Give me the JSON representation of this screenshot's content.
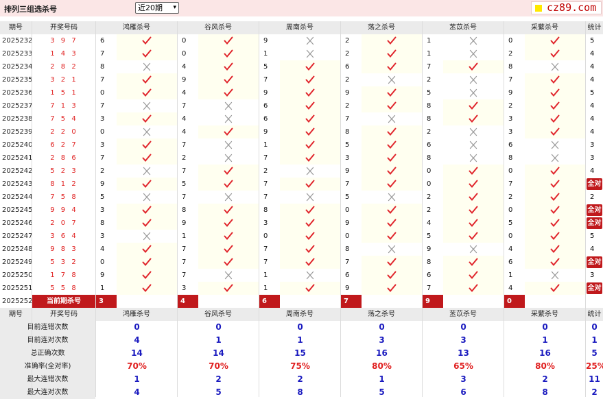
{
  "header": {
    "title": "排列三组选杀号",
    "period_select": "近20期",
    "logo": "cz89.com"
  },
  "columns": {
    "issue": "期号",
    "draw": "开奖号码",
    "experts": [
      "鸿雁杀号",
      "谷风杀号",
      "周南杀号",
      "荡之杀号",
      "苤苡杀号",
      "采蘩杀号"
    ],
    "stat": "统计"
  },
  "rows": [
    {
      "issue": "2025232",
      "draw": "3 9 7",
      "picks": [
        [
          "6",
          "ok"
        ],
        [
          "0",
          "ok"
        ],
        [
          "9",
          "no"
        ],
        [
          "2",
          "ok"
        ],
        [
          "1",
          "no"
        ],
        [
          "0",
          "ok"
        ]
      ],
      "stat": "5"
    },
    {
      "issue": "2025233",
      "draw": "1 4 3",
      "picks": [
        [
          "7",
          "ok"
        ],
        [
          "0",
          "ok"
        ],
        [
          "1",
          "no"
        ],
        [
          "2",
          "ok"
        ],
        [
          "1",
          "no"
        ],
        [
          "2",
          "ok"
        ]
      ],
      "stat": "4"
    },
    {
      "issue": "2025234",
      "draw": "2 8 2",
      "picks": [
        [
          "8",
          "no"
        ],
        [
          "4",
          "ok"
        ],
        [
          "5",
          "ok"
        ],
        [
          "6",
          "ok"
        ],
        [
          "7",
          "ok"
        ],
        [
          "8",
          "no"
        ]
      ],
      "stat": "4"
    },
    {
      "issue": "2025235",
      "draw": "3 2 1",
      "picks": [
        [
          "7",
          "ok"
        ],
        [
          "9",
          "ok"
        ],
        [
          "7",
          "ok"
        ],
        [
          "2",
          "no"
        ],
        [
          "2",
          "no"
        ],
        [
          "7",
          "ok"
        ]
      ],
      "stat": "4"
    },
    {
      "issue": "2025236",
      "draw": "1 5 1",
      "picks": [
        [
          "0",
          "ok"
        ],
        [
          "4",
          "ok"
        ],
        [
          "9",
          "ok"
        ],
        [
          "9",
          "ok"
        ],
        [
          "5",
          "no"
        ],
        [
          "9",
          "ok"
        ]
      ],
      "stat": "5"
    },
    {
      "issue": "2025237",
      "draw": "7 1 3",
      "picks": [
        [
          "7",
          "no"
        ],
        [
          "7",
          "no"
        ],
        [
          "6",
          "ok"
        ],
        [
          "2",
          "ok"
        ],
        [
          "8",
          "ok"
        ],
        [
          "2",
          "ok"
        ]
      ],
      "stat": "4"
    },
    {
      "issue": "2025238",
      "draw": "7 5 4",
      "picks": [
        [
          "3",
          "ok"
        ],
        [
          "4",
          "no"
        ],
        [
          "6",
          "ok"
        ],
        [
          "7",
          "no"
        ],
        [
          "8",
          "ok"
        ],
        [
          "3",
          "ok"
        ]
      ],
      "stat": "4"
    },
    {
      "issue": "2025239",
      "draw": "2 2 0",
      "picks": [
        [
          "0",
          "no"
        ],
        [
          "4",
          "ok"
        ],
        [
          "9",
          "ok"
        ],
        [
          "8",
          "ok"
        ],
        [
          "2",
          "no"
        ],
        [
          "3",
          "ok"
        ]
      ],
      "stat": "4"
    },
    {
      "issue": "2025240",
      "draw": "6 2 7",
      "picks": [
        [
          "3",
          "ok"
        ],
        [
          "7",
          "no"
        ],
        [
          "1",
          "ok"
        ],
        [
          "5",
          "ok"
        ],
        [
          "6",
          "no"
        ],
        [
          "6",
          "no"
        ]
      ],
      "stat": "3"
    },
    {
      "issue": "2025241",
      "draw": "2 8 6",
      "picks": [
        [
          "7",
          "ok"
        ],
        [
          "2",
          "no"
        ],
        [
          "7",
          "ok"
        ],
        [
          "3",
          "ok"
        ],
        [
          "8",
          "no"
        ],
        [
          "8",
          "no"
        ]
      ],
      "stat": "3"
    },
    {
      "issue": "2025242",
      "draw": "5 2 3",
      "picks": [
        [
          "2",
          "no"
        ],
        [
          "7",
          "ok"
        ],
        [
          "2",
          "no"
        ],
        [
          "9",
          "ok"
        ],
        [
          "0",
          "ok"
        ],
        [
          "0",
          "ok"
        ]
      ],
      "stat": "4"
    },
    {
      "issue": "2025243",
      "draw": "8 1 2",
      "picks": [
        [
          "9",
          "ok"
        ],
        [
          "5",
          "ok"
        ],
        [
          "7",
          "ok"
        ],
        [
          "7",
          "ok"
        ],
        [
          "0",
          "ok"
        ],
        [
          "7",
          "ok"
        ]
      ],
      "stat": "全对"
    },
    {
      "issue": "2025244",
      "draw": "7 5 8",
      "picks": [
        [
          "5",
          "no"
        ],
        [
          "7",
          "no"
        ],
        [
          "7",
          "no"
        ],
        [
          "5",
          "no"
        ],
        [
          "2",
          "ok"
        ],
        [
          "2",
          "ok"
        ]
      ],
      "stat": "2"
    },
    {
      "issue": "2025245",
      "draw": "9 9 4",
      "picks": [
        [
          "3",
          "ok"
        ],
        [
          "8",
          "ok"
        ],
        [
          "8",
          "ok"
        ],
        [
          "0",
          "ok"
        ],
        [
          "2",
          "ok"
        ],
        [
          "0",
          "ok"
        ]
      ],
      "stat": "全对"
    },
    {
      "issue": "2025246",
      "draw": "2 0 7",
      "picks": [
        [
          "8",
          "ok"
        ],
        [
          "9",
          "ok"
        ],
        [
          "3",
          "ok"
        ],
        [
          "9",
          "ok"
        ],
        [
          "4",
          "ok"
        ],
        [
          "5",
          "ok"
        ]
      ],
      "stat": "全对"
    },
    {
      "issue": "2025247",
      "draw": "3 6 4",
      "picks": [
        [
          "3",
          "no"
        ],
        [
          "1",
          "ok"
        ],
        [
          "0",
          "ok"
        ],
        [
          "0",
          "ok"
        ],
        [
          "5",
          "ok"
        ],
        [
          "0",
          "ok"
        ]
      ],
      "stat": "5"
    },
    {
      "issue": "2025248",
      "draw": "9 8 3",
      "picks": [
        [
          "4",
          "ok"
        ],
        [
          "7",
          "ok"
        ],
        [
          "7",
          "ok"
        ],
        [
          "8",
          "no"
        ],
        [
          "9",
          "no"
        ],
        [
          "4",
          "ok"
        ]
      ],
      "stat": "4"
    },
    {
      "issue": "2025249",
      "draw": "5 3 2",
      "picks": [
        [
          "0",
          "ok"
        ],
        [
          "7",
          "ok"
        ],
        [
          "7",
          "ok"
        ],
        [
          "7",
          "ok"
        ],
        [
          "8",
          "ok"
        ],
        [
          "6",
          "ok"
        ]
      ],
      "stat": "全对"
    },
    {
      "issue": "2025250",
      "draw": "1 7 8",
      "picks": [
        [
          "9",
          "ok"
        ],
        [
          "7",
          "no"
        ],
        [
          "1",
          "no"
        ],
        [
          "6",
          "ok"
        ],
        [
          "6",
          "ok"
        ],
        [
          "1",
          "no"
        ]
      ],
      "stat": "3"
    },
    {
      "issue": "2025251",
      "draw": "5 5 8",
      "picks": [
        [
          "1",
          "ok"
        ],
        [
          "3",
          "ok"
        ],
        [
          "1",
          "ok"
        ],
        [
          "9",
          "ok"
        ],
        [
          "7",
          "ok"
        ],
        [
          "4",
          "ok"
        ]
      ],
      "stat": "全对"
    }
  ],
  "current": {
    "issue": "2025252",
    "label": "当前期杀号",
    "picks": [
      "3",
      "4",
      "6",
      "7",
      "9",
      "0"
    ]
  },
  "stats_header": {
    "issue": "期号",
    "draw": "开奖号码",
    "experts": [
      "鸿雁杀号",
      "谷风杀号",
      "周南杀号",
      "荡之杀号",
      "苤苡杀号",
      "采蘩杀号"
    ],
    "stat": "统计"
  },
  "stats": [
    {
      "label": "目前连错次数",
      "values": [
        "0",
        "0",
        "0",
        "0",
        "0",
        "0"
      ],
      "stat": "0",
      "kind": "num"
    },
    {
      "label": "目前连对次数",
      "values": [
        "4",
        "1",
        "1",
        "3",
        "3",
        "1"
      ],
      "stat": "1",
      "kind": "num"
    },
    {
      "label": "总正确次数",
      "values": [
        "14",
        "14",
        "15",
        "16",
        "13",
        "16"
      ],
      "stat": "5",
      "kind": "num"
    },
    {
      "label": "准确率(全对率)",
      "values": [
        "70%",
        "70%",
        "75%",
        "80%",
        "65%",
        "80%"
      ],
      "stat": "25%",
      "kind": "rate"
    },
    {
      "label": "最大连错次数",
      "values": [
        "1",
        "2",
        "2",
        "1",
        "3",
        "2"
      ],
      "stat": "11",
      "kind": "num"
    },
    {
      "label": "最大连对次数",
      "values": [
        "4",
        "5",
        "8",
        "5",
        "6",
        "8"
      ],
      "stat": "2",
      "kind": "num"
    }
  ],
  "colors": {
    "check": "#e0242b",
    "cross": "#9a9a9a",
    "accent": "#c0191c",
    "stat_blue": "#1a1abf"
  }
}
